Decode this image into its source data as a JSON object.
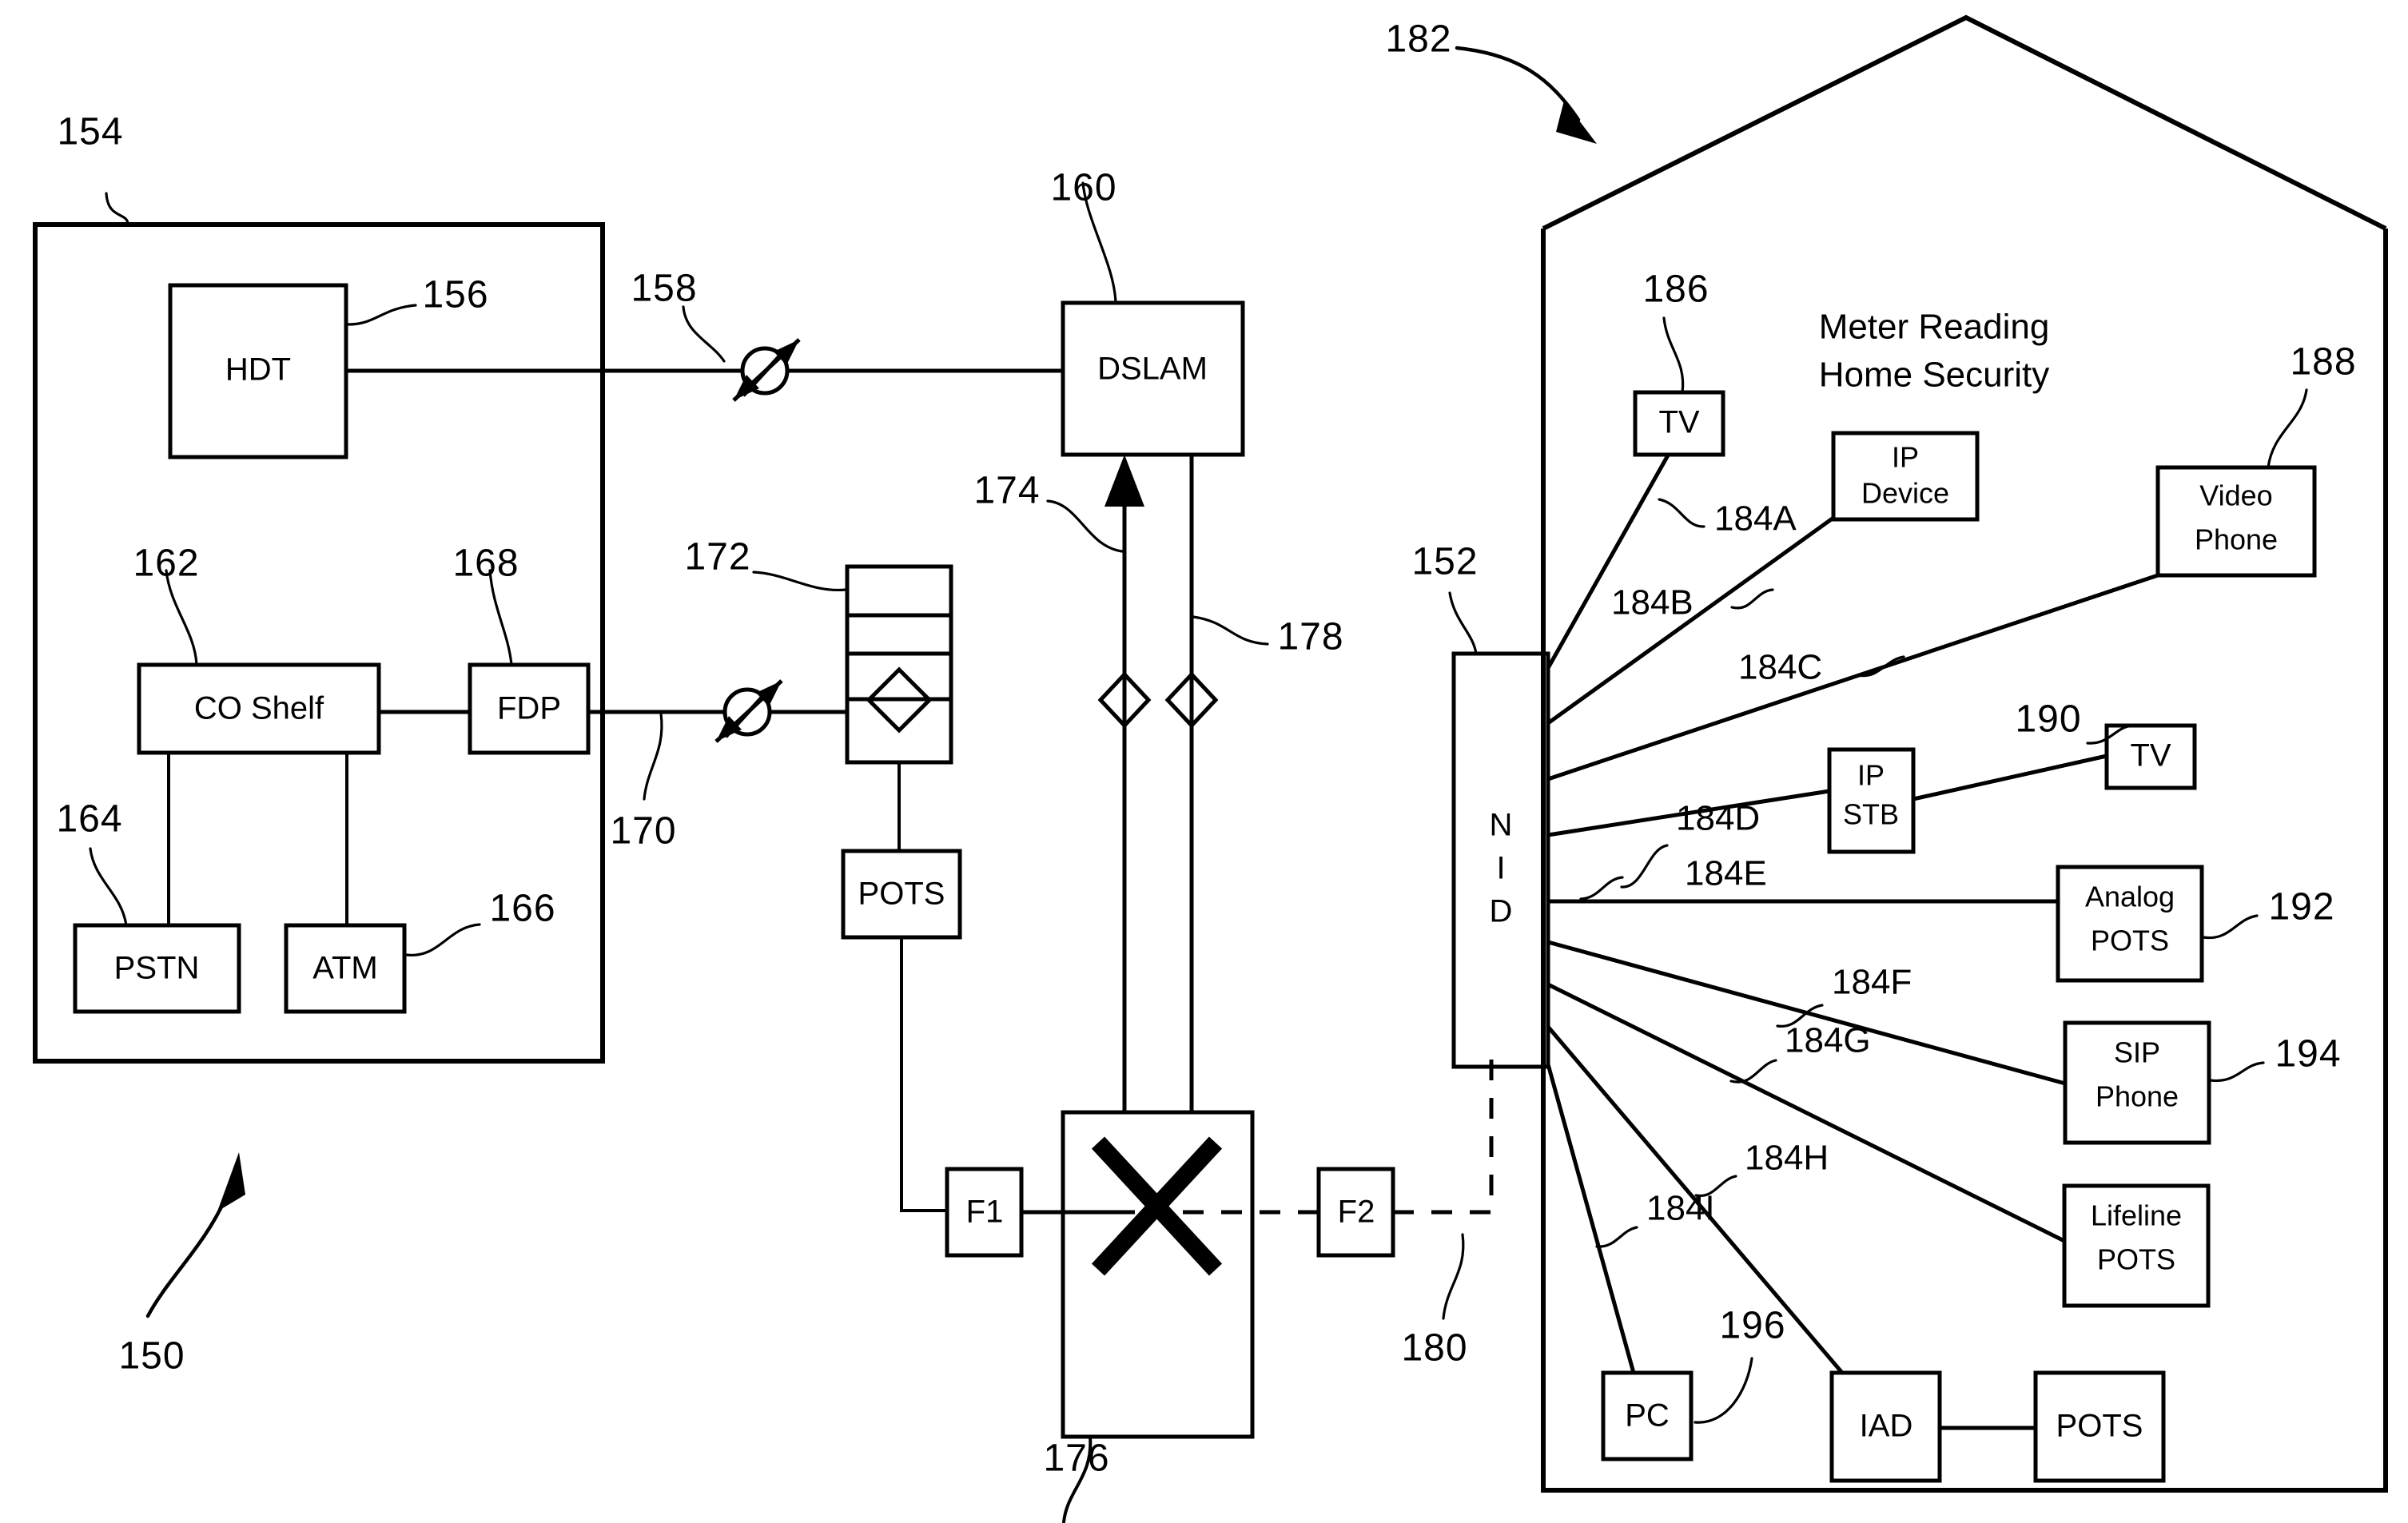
{
  "figure": {
    "title": "Telecommunications access network with NID and customer premises devices",
    "background_color": "#ffffff",
    "ink_color": "#000000"
  },
  "central_office": {
    "ref": "154",
    "boxes": {
      "hdt": {
        "label": "HDT",
        "ref": "156"
      },
      "co_shelf": {
        "label": "CO Shelf",
        "ref": "162"
      },
      "fdp": {
        "label": "FDP",
        "ref": "168"
      },
      "pstn": {
        "label": "PSTN",
        "ref": "164"
      },
      "atm": {
        "label": "ATM",
        "ref": "166"
      }
    },
    "overall_ref": "150"
  },
  "network": {
    "optic_link_upper_ref": "158",
    "optic_link_lower_ref": "170",
    "dslam": {
      "label": "DSLAM",
      "ref": "160"
    },
    "rack": {
      "ref": "172"
    },
    "pots_co": {
      "label": "POTS"
    },
    "upstream_fiber_ref": "174",
    "downstream_fiber_ref": "178",
    "crossconnect": {
      "ref": "176"
    },
    "filter_1": {
      "label": "F1"
    },
    "filter_2": {
      "label": "F2"
    },
    "drop_ref": "180"
  },
  "premises": {
    "house_ref": "182",
    "caption_line1": "Meter Reading",
    "caption_line2": "Home Security",
    "nid": {
      "label_chars": [
        "N",
        "I",
        "D"
      ],
      "ref": "152"
    },
    "branch_refs": [
      "184A",
      "184B",
      "184C",
      "184D",
      "184E",
      "184F",
      "184G",
      "184H",
      "184I"
    ],
    "devices": [
      {
        "label": "TV",
        "ref": "186",
        "branch": "184A"
      },
      {
        "label_line1": "IP",
        "label_line2": "Device",
        "branch": "184B"
      },
      {
        "label_line1": "Video",
        "label_line2": "Phone",
        "ref": "188",
        "branch": "184C"
      },
      {
        "label_line1": "IP",
        "label_line2": "STB",
        "branch": "184D"
      },
      {
        "label": "TV",
        "ref": "190"
      },
      {
        "label_line1": "Analog",
        "label_line2": "POTS",
        "ref": "192",
        "branch": "184E"
      },
      {
        "label_line1": "SIP",
        "label_line2": "Phone",
        "ref": "194",
        "branch": "184F"
      },
      {
        "label_line1": "Lifeline",
        "label_line2": "POTS",
        "branch": "184G"
      },
      {
        "label": "PC",
        "branch": "184I"
      },
      {
        "label": "IAD",
        "ref": "196",
        "branch": "184H"
      },
      {
        "label": "POTS"
      }
    ]
  },
  "labels": {
    "hdt": "HDT",
    "co_shelf": "CO Shelf",
    "fdp": "FDP",
    "pstn": "PSTN",
    "atm": "ATM",
    "dslam": "DSLAM",
    "pots": "POTS",
    "f1": "F1",
    "f2": "F2",
    "tv": "TV",
    "tv2": "TV",
    "ip": "IP",
    "device": "Device",
    "video": "Video",
    "phone": "Phone",
    "stb": "STB",
    "analog": "Analog",
    "analog_pots": "POTS",
    "sip": "SIP",
    "sip_phone": "Phone",
    "lifeline": "Lifeline",
    "lifeline_pots": "POTS",
    "pc": "PC",
    "iad": "IAD",
    "iad_pots": "POTS",
    "nid_n": "N",
    "nid_i": "I",
    "nid_d": "D",
    "meter_reading": "Meter Reading",
    "home_security": "Home Security"
  },
  "refs": {
    "r150": "150",
    "r152": "152",
    "r154": "154",
    "r156": "156",
    "r158": "158",
    "r160": "160",
    "r162": "162",
    "r164": "164",
    "r166": "166",
    "r168": "168",
    "r170": "170",
    "r172": "172",
    "r174": "174",
    "r176": "176",
    "r178": "178",
    "r180": "180",
    "r182": "182",
    "r184A": "184A",
    "r184B": "184B",
    "r184C": "184C",
    "r184D": "184D",
    "r184E": "184E",
    "r184F": "184F",
    "r184G": "184G",
    "r184H": "184H",
    "r184I": "184I",
    "r186": "186",
    "r188": "188",
    "r190": "190",
    "r192": "192",
    "r194": "194",
    "r196": "196"
  }
}
